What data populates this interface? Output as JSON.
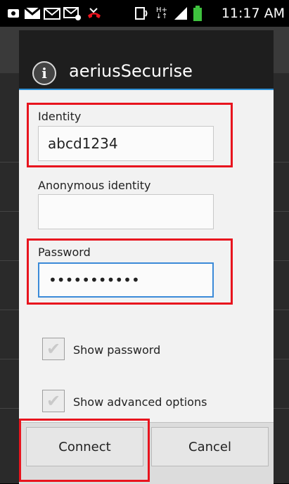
{
  "status_bar": {
    "icons": [
      "screenshot-icon",
      "gmail-icon",
      "email-icon",
      "email-attachment-icon",
      "missed-call-icon",
      "nfc-icon",
      "network-hplus-icon",
      "signal-icon",
      "battery-icon"
    ],
    "time": "11:17 AM"
  },
  "dialog": {
    "title": "aeriusSecurise",
    "identity": {
      "label": "Identity",
      "value": "abcd1234"
    },
    "anonymous_identity": {
      "label": "Anonymous identity",
      "value": ""
    },
    "password": {
      "label": "Password",
      "value": "•••••••••••"
    },
    "show_password": {
      "label": "Show password",
      "checked": false
    },
    "show_advanced": {
      "label": "Show advanced options",
      "checked": false
    },
    "buttons": {
      "connect": "Connect",
      "cancel": "Cancel"
    }
  },
  "colors": {
    "highlight": "#e8141e",
    "focus": "#3b8ad8",
    "header_line": "#2c8fd6"
  }
}
